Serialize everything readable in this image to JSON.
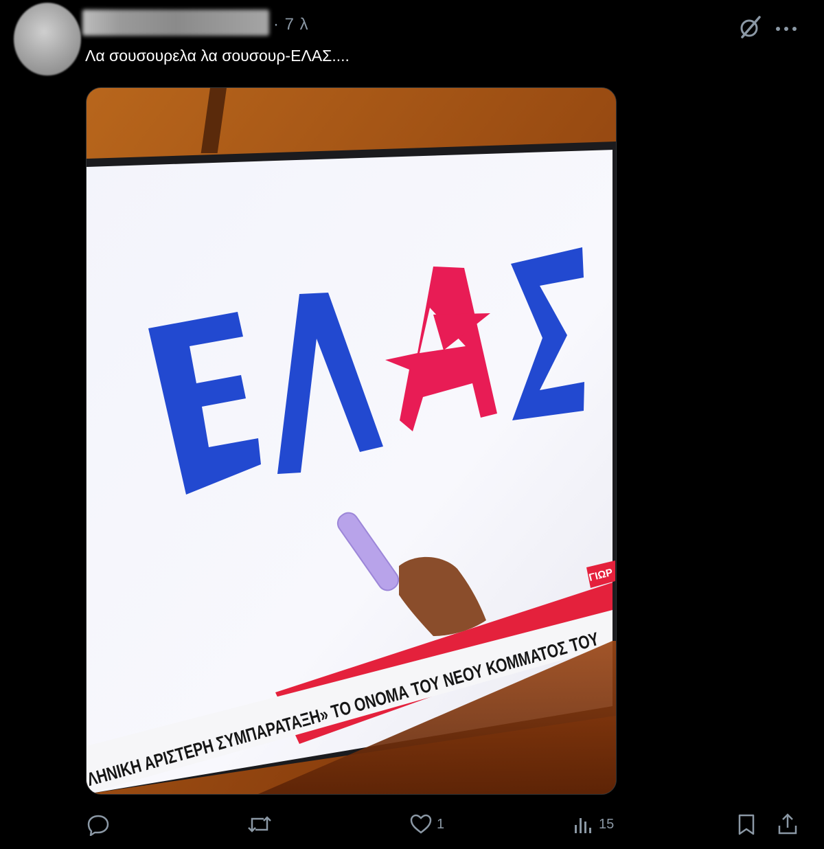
{
  "post": {
    "time": "· 7 λ",
    "text": "Λα σουσουρελα λα σουσουρ-ΕΛΑΣ....",
    "media": {
      "logo_letters": [
        "Ε",
        "Λ",
        "Α",
        "Σ"
      ],
      "ticker_text": "ΛΗΝΙΚΗ ΑΡΙΣΤΕΡΗ ΣΥΜΠΑΡΑΤΑΞΗ» ΤΟ ΟΝΟΜΑ ΤΟΥ ΝΕΟΥ ΚΟΜΜΑΤΟΣ ΤΟΥ",
      "corner_label": "ΓΙΩΡ",
      "colors": {
        "blue": "#2149cf",
        "red": "#e81c55",
        "wall": "#8b4212"
      }
    }
  },
  "icons": {
    "grok": "grok-icon",
    "more": "more-icon",
    "reply": "reply-icon",
    "repost": "repost-icon",
    "like": "heart-icon",
    "views": "views-icon",
    "bookmark": "bookmark-icon",
    "share": "share-icon"
  },
  "actions": {
    "reply_count": "",
    "repost_count": "",
    "like_count": "1",
    "views_count": "15"
  }
}
